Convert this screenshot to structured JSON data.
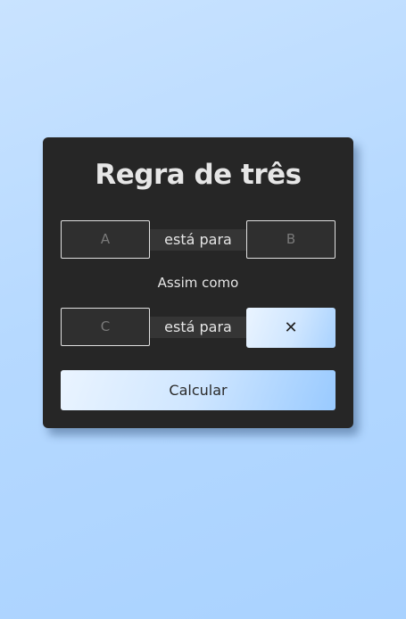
{
  "app": {
    "title": "Regra de três"
  },
  "row1": {
    "input_a_placeholder": "A",
    "connector": "está para",
    "input_b_placeholder": "B"
  },
  "middle_text": "Assim como",
  "row2": {
    "input_c_placeholder": "C",
    "connector": "está para",
    "result_value": "✕"
  },
  "actions": {
    "calculate_label": "Calcular"
  },
  "colors": {
    "card_background": "#262626",
    "text": "#e6e6e6",
    "accent_gradient_start": "#eaf4ff",
    "accent_gradient_end": "#99caff"
  }
}
